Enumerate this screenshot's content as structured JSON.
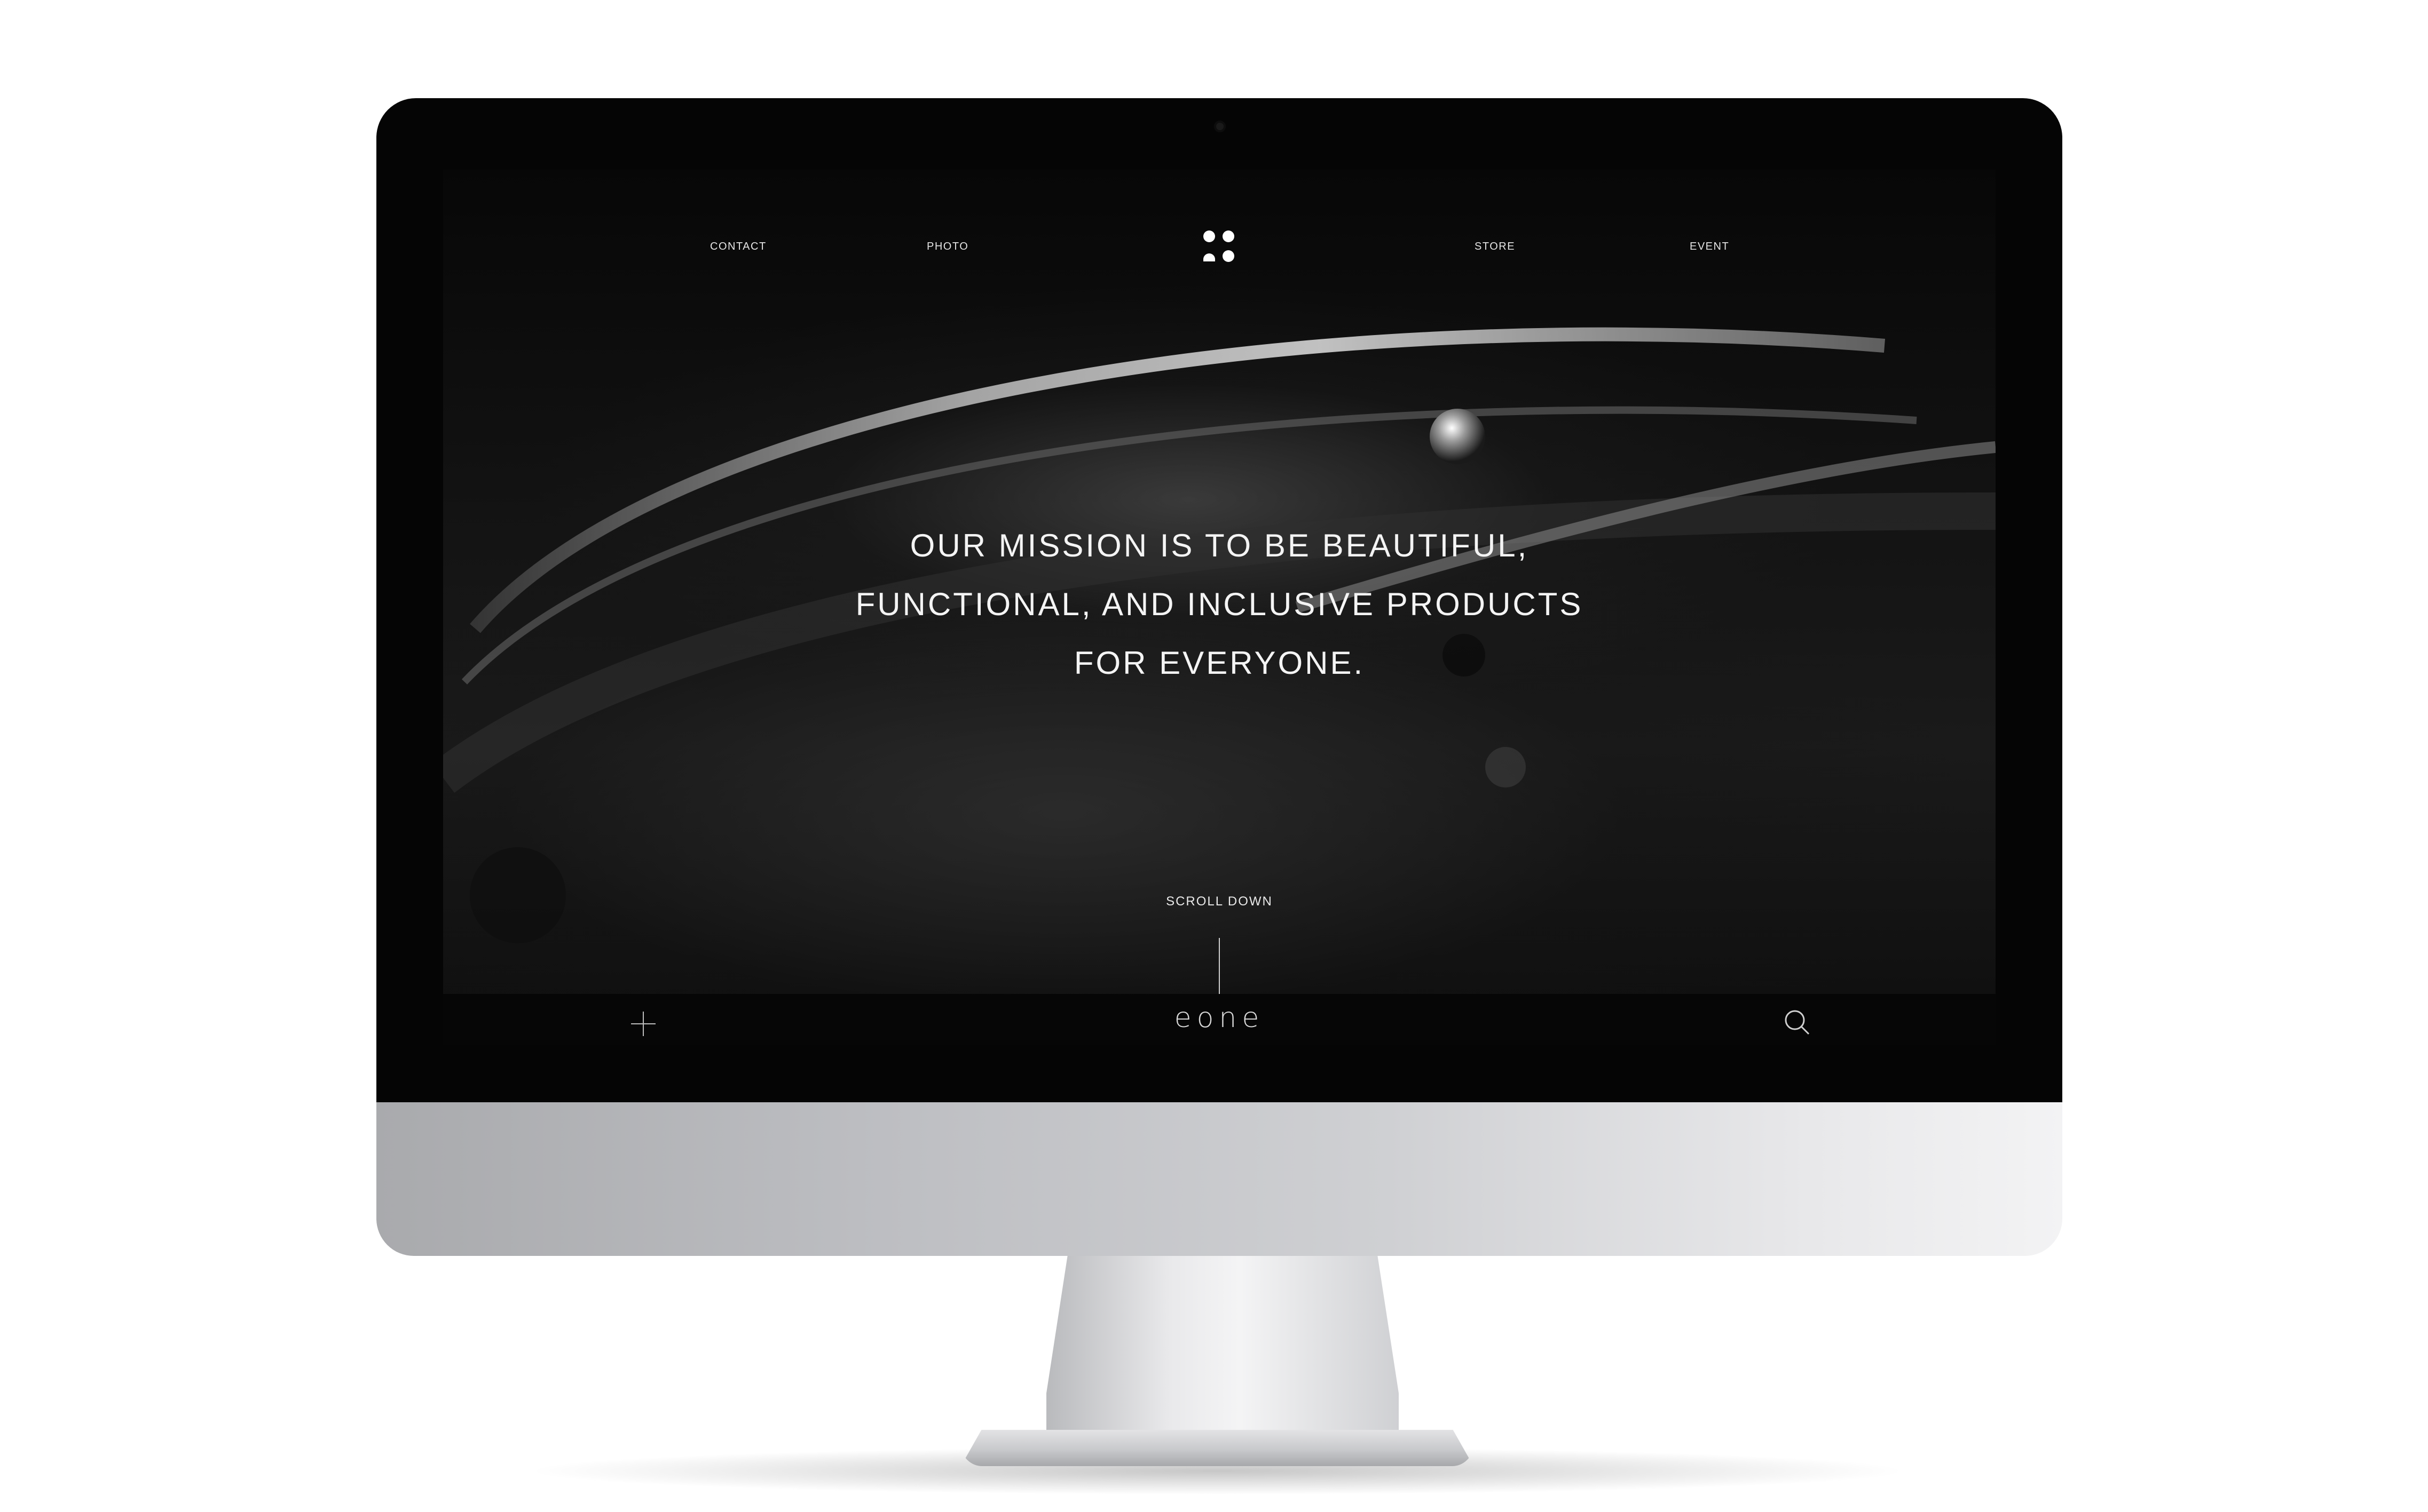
{
  "nav": {
    "left": [
      "CONTACT",
      "PHOTO"
    ],
    "right": [
      "STORE",
      "EVENT"
    ]
  },
  "hero": {
    "mission_lines": [
      "OUR MISSION IS TO BE BEAUTIFUL,",
      "FUNCTIONAL, AND INCLUSIVE PRODUCTS",
      "FOR EVERYONE."
    ],
    "scroll_label": "SCROLL DOWN"
  },
  "footer": {
    "wordmark": "eone",
    "left_icon": "plus-icon",
    "right_icon": "search-icon"
  },
  "colors": {
    "screen_background": "#060606",
    "text": "#f4f4f4",
    "bezel": "#050505"
  }
}
